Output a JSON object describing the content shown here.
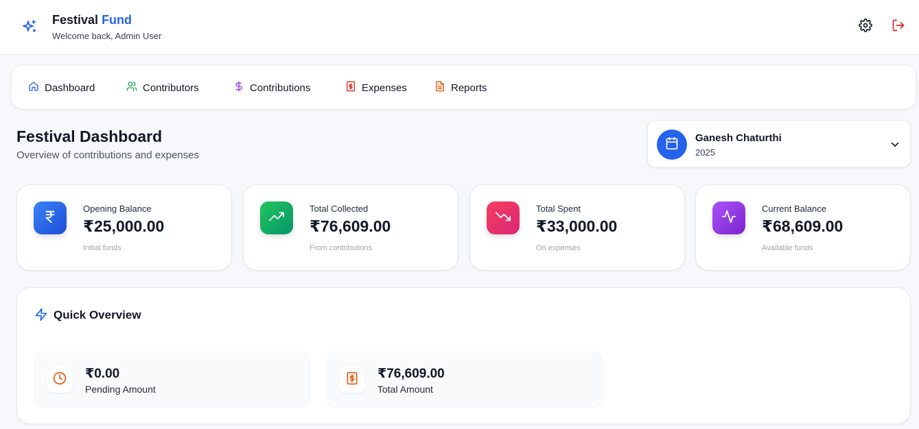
{
  "header": {
    "title_main": "Festival",
    "title_accent": "Fund",
    "welcome": "Welcome back, Admin User",
    "icons": {
      "logo": "sparkles-icon",
      "settings": "gear-icon",
      "logout": "logout-icon"
    },
    "accent_color": "#2563eb",
    "logout_color": "#dc2626"
  },
  "nav": {
    "items": [
      {
        "label": "Dashboard",
        "icon": "home-icon",
        "color": "#2563eb"
      },
      {
        "label": "Contributors",
        "icon": "users-icon",
        "color": "#16a34a"
      },
      {
        "label": "Contributions",
        "icon": "dollar-icon",
        "color": "#9333ea"
      },
      {
        "label": "Expenses",
        "icon": "receipt-icon",
        "color": "#dc2626"
      },
      {
        "label": "Reports",
        "icon": "file-text-icon",
        "color": "#ea580c"
      }
    ]
  },
  "page": {
    "title": "Festival Dashboard",
    "subtitle": "Overview of contributions and expenses"
  },
  "festival": {
    "name": "Ganesh Chaturthi",
    "year": "2025",
    "icon": "calendar-icon"
  },
  "stats": [
    {
      "label": "Opening Balance",
      "value": "₹25,000.00",
      "sub": "Initial funds",
      "icon": "rupee-icon",
      "color_from": "#2563eb",
      "color_to": "#1d4ed8"
    },
    {
      "label": "Total Collected",
      "value": "₹76,609.00",
      "sub": "From contributions",
      "icon": "trending-up-icon",
      "color_from": "#16a34a",
      "color_to": "#059669"
    },
    {
      "label": "Total Spent",
      "value": "₹33,000.00",
      "sub": "On expenses",
      "icon": "trending-down-icon",
      "color_from": "#e11d48",
      "color_to": "#db2777"
    },
    {
      "label": "Current Balance",
      "value": "₹68,609.00",
      "sub": "Available funds",
      "icon": "activity-icon",
      "color_from": "#9333ea",
      "color_to": "#7e22ce"
    }
  ],
  "overview": {
    "title": "Quick Overview",
    "icon": "zap-icon",
    "tiles": [
      {
        "value": "₹0.00",
        "label": "Pending Amount",
        "icon": "clock-icon",
        "color": "#ea580c"
      },
      {
        "value": "₹76,609.00",
        "label": "Total Amount",
        "icon": "receipt-icon",
        "color": "#ea580c"
      }
    ]
  }
}
